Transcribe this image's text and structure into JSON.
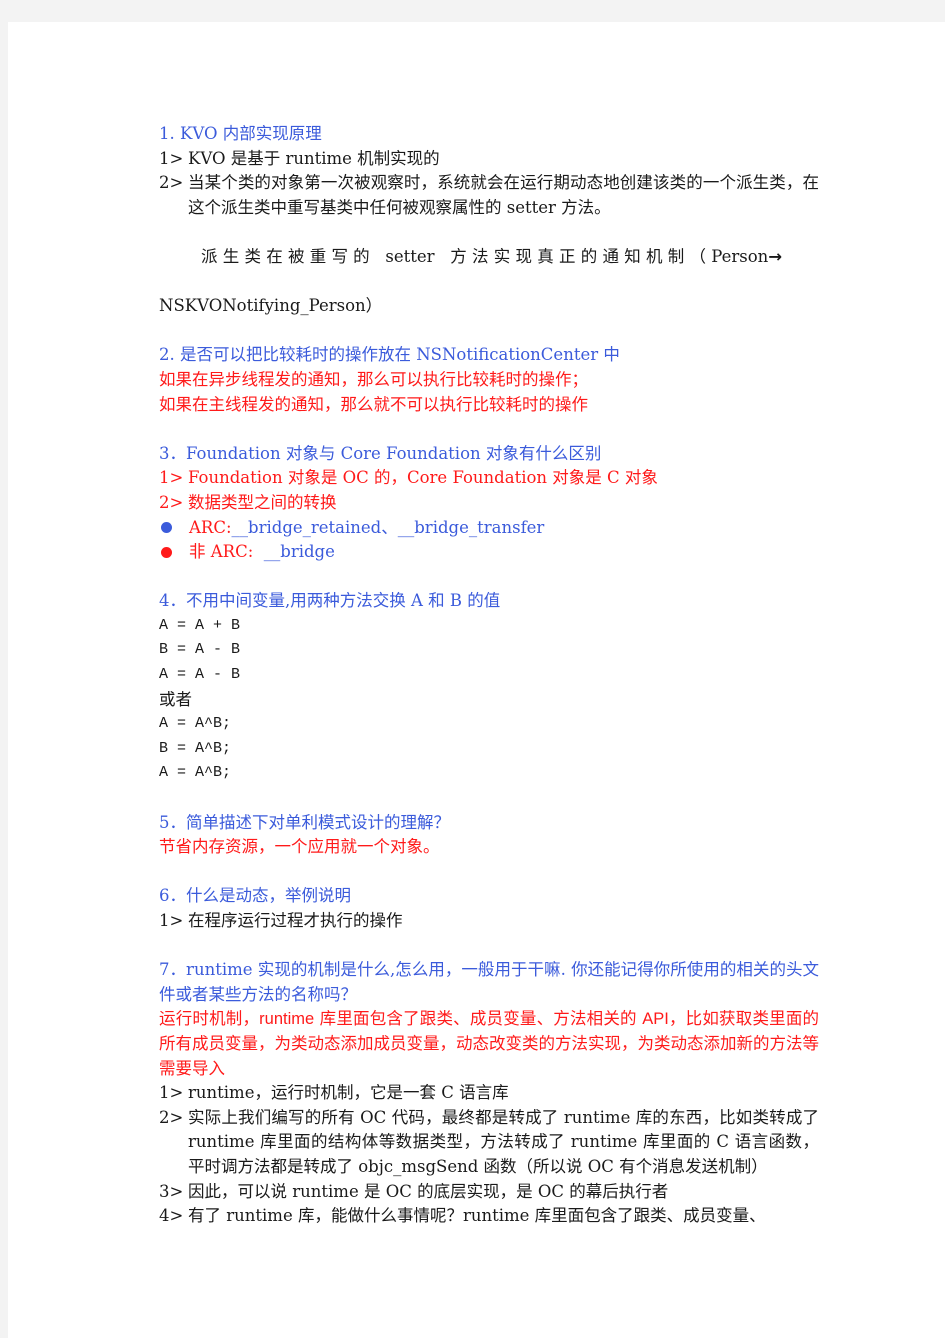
{
  "colors": {
    "question": "#3b5bdb",
    "answer_red": "#ff1a1a",
    "body": "#1a1a1a",
    "page_background": "#f3f3f3",
    "sheet": "#ffffff"
  },
  "sections": {
    "s1": {
      "title": "1.  KVO 内部实现原理",
      "items": [
        {
          "marker": "1>",
          "text": "KVO 是基于 runtime 机制实现的"
        },
        {
          "marker": "2>",
          "text": "当某个类的对象第一次被观察时，系统就会在运行期动态地创建该类的一个派生类，在这个派生类中重写基类中任何被观察属性的  setter   方法。"
        }
      ],
      "note_line1": "派 生 类 在 被 重 写 的   setter   方 法 实 现 真 正 的 通 知 机 制 （ Person",
      "note_arrow": "→",
      "note_line2": "NSKVONotifying_Person）"
    },
    "s2": {
      "title": "2.  是否可以把比较耗时的操作放在 NSNotificationCenter 中",
      "answers": [
        "如果在异步线程发的通知，那么可以执行比较耗时的操作；",
        "如果在主线程发的通知，那么就不可以执行比较耗时的操作"
      ]
    },
    "s3": {
      "title": "3．Foundation 对象与 Core  Foundation 对象有什么区别",
      "items": [
        {
          "marker": "1>",
          "text": "Foundation 对象是 OC 的，Core  Foundation 对象是 C 对象"
        },
        {
          "marker": "2>",
          "text": "数据类型之间的转换"
        }
      ],
      "bullets": [
        {
          "label": "ARC:",
          "text": "__bridge_retained、__bridge_transfer"
        },
        {
          "label": "非 ARC:",
          "text": "  __bridge"
        }
      ]
    },
    "s4": {
      "title": "4．不用中间变量,用两种方法交换 A 和 B 的值",
      "method1": [
        "A = A + B",
        "B = A - B",
        "A = A - B"
      ],
      "or": "或者",
      "method2": [
        "A = A^B;",
        "B = A^B;",
        "A = A^B;"
      ]
    },
    "s5": {
      "title": "5．简单描述下对单利模式设计的理解？",
      "answer": "节省内存资源，一个应用就一个对象。"
    },
    "s6": {
      "title": "6．什么是动态，举例说明",
      "items": [
        {
          "marker": "1>",
          "text": "在程序运行过程才执行的操作"
        }
      ]
    },
    "s7": {
      "title": "7．runtime  实现的机制是什么,怎么用，一般用于干嘛. 你还能记得你所使用的相关的头文件或者某些方法的名称吗？",
      "answer_a": "运行时机制，",
      "answer_b": "runtime",
      "answer_c": " 库里面包含了跟类、成员变量、方法相关的 ",
      "answer_d": "API",
      "answer_e": "，比如获取类里面的所有成员变量，为类动态添加成员变量，动态改变类的方法实现，为类动态添加新的方法等  需要导入",
      "items": [
        {
          "marker": "1>",
          "text": "runtime，运行时机制，它是一套 C 语言库"
        },
        {
          "marker": "2>",
          "text": "实际上我们编写的所有 OC 代码，最终都是转成了 runtime 库的东西，比如类转成了 runtime 库里面的结构体等数据类型，方法转成了 runtime 库里面的 C 语言函数，平时调方法都是转成了 objc_msgSend 函数（所以说 OC 有个消息发送机制）"
        },
        {
          "marker": "3>",
          "text": "因此，可以说 runtime 是 OC 的底层实现，是 OC 的幕后执行者"
        },
        {
          "marker": "4>",
          "text": "有了 runtime 库，能做什么事情呢？runtime 库里面包含了跟类、成员变量、"
        }
      ]
    }
  }
}
